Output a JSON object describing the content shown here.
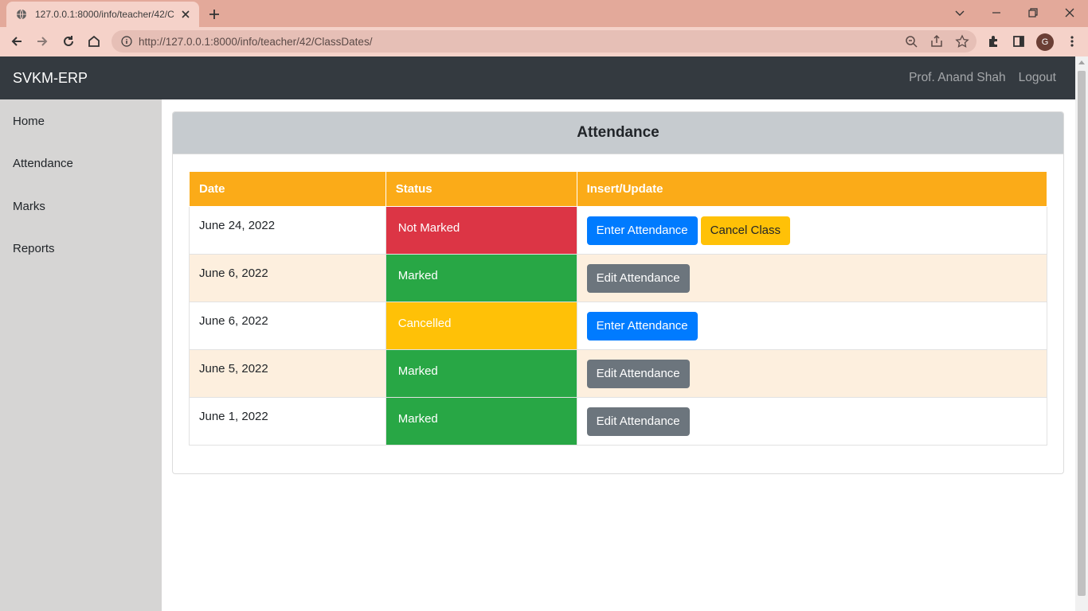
{
  "browser": {
    "tab_title": "127.0.0.1:8000/info/teacher/42/C",
    "url": "http://127.0.0.1:8000/info/teacher/42/ClassDates/",
    "profile_initial": "G"
  },
  "navbar": {
    "brand": "SVKM-ERP",
    "user_name": "Prof. Anand Shah",
    "logout_label": "Logout"
  },
  "sidebar": {
    "items": [
      {
        "label": "Home"
      },
      {
        "label": "Attendance"
      },
      {
        "label": "Marks"
      },
      {
        "label": "Reports"
      }
    ]
  },
  "card": {
    "title": "Attendance"
  },
  "table": {
    "headers": [
      "Date",
      "Status",
      "Insert/Update"
    ],
    "rows": [
      {
        "date": "June 24, 2022",
        "status": "Not Marked",
        "status_color": "#dc3545",
        "actions": [
          "Enter Attendance",
          "Cancel Class"
        ]
      },
      {
        "date": "June 6, 2022",
        "status": "Marked",
        "status_color": "#28a745",
        "actions": [
          "Edit Attendance"
        ]
      },
      {
        "date": "June 6, 2022",
        "status": "Cancelled",
        "status_color": "#ffc107",
        "actions": [
          "Enter Attendance"
        ]
      },
      {
        "date": "June 5, 2022",
        "status": "Marked",
        "status_color": "#28a745",
        "actions": [
          "Edit Attendance"
        ]
      },
      {
        "date": "June 1, 2022",
        "status": "Marked",
        "status_color": "#28a745",
        "actions": [
          "Edit Attendance"
        ]
      }
    ]
  },
  "colors": {
    "navbar_bg": "#343a40",
    "table_header_bg": "#fbab18",
    "primary": "#007bff",
    "warning": "#ffc107",
    "secondary": "#6c757d",
    "danger": "#dc3545",
    "success": "#28a745"
  }
}
